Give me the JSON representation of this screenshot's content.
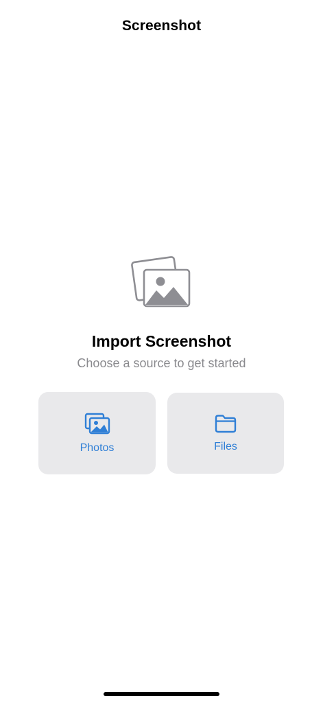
{
  "nav": {
    "title": "Screenshot"
  },
  "empty_state": {
    "icon": "photo-stack-icon",
    "title": "Import Screenshot",
    "subtitle": "Choose a source to get started"
  },
  "sources": {
    "photos": {
      "label": "Photos",
      "icon": "photos-icon"
    },
    "files": {
      "label": "Files",
      "icon": "folder-icon"
    }
  },
  "colors": {
    "accent": "#2f7fd6",
    "card_background": "#e9e9eb",
    "secondary_text": "#8a8a8e",
    "hero_icon": "#8e8e93"
  }
}
